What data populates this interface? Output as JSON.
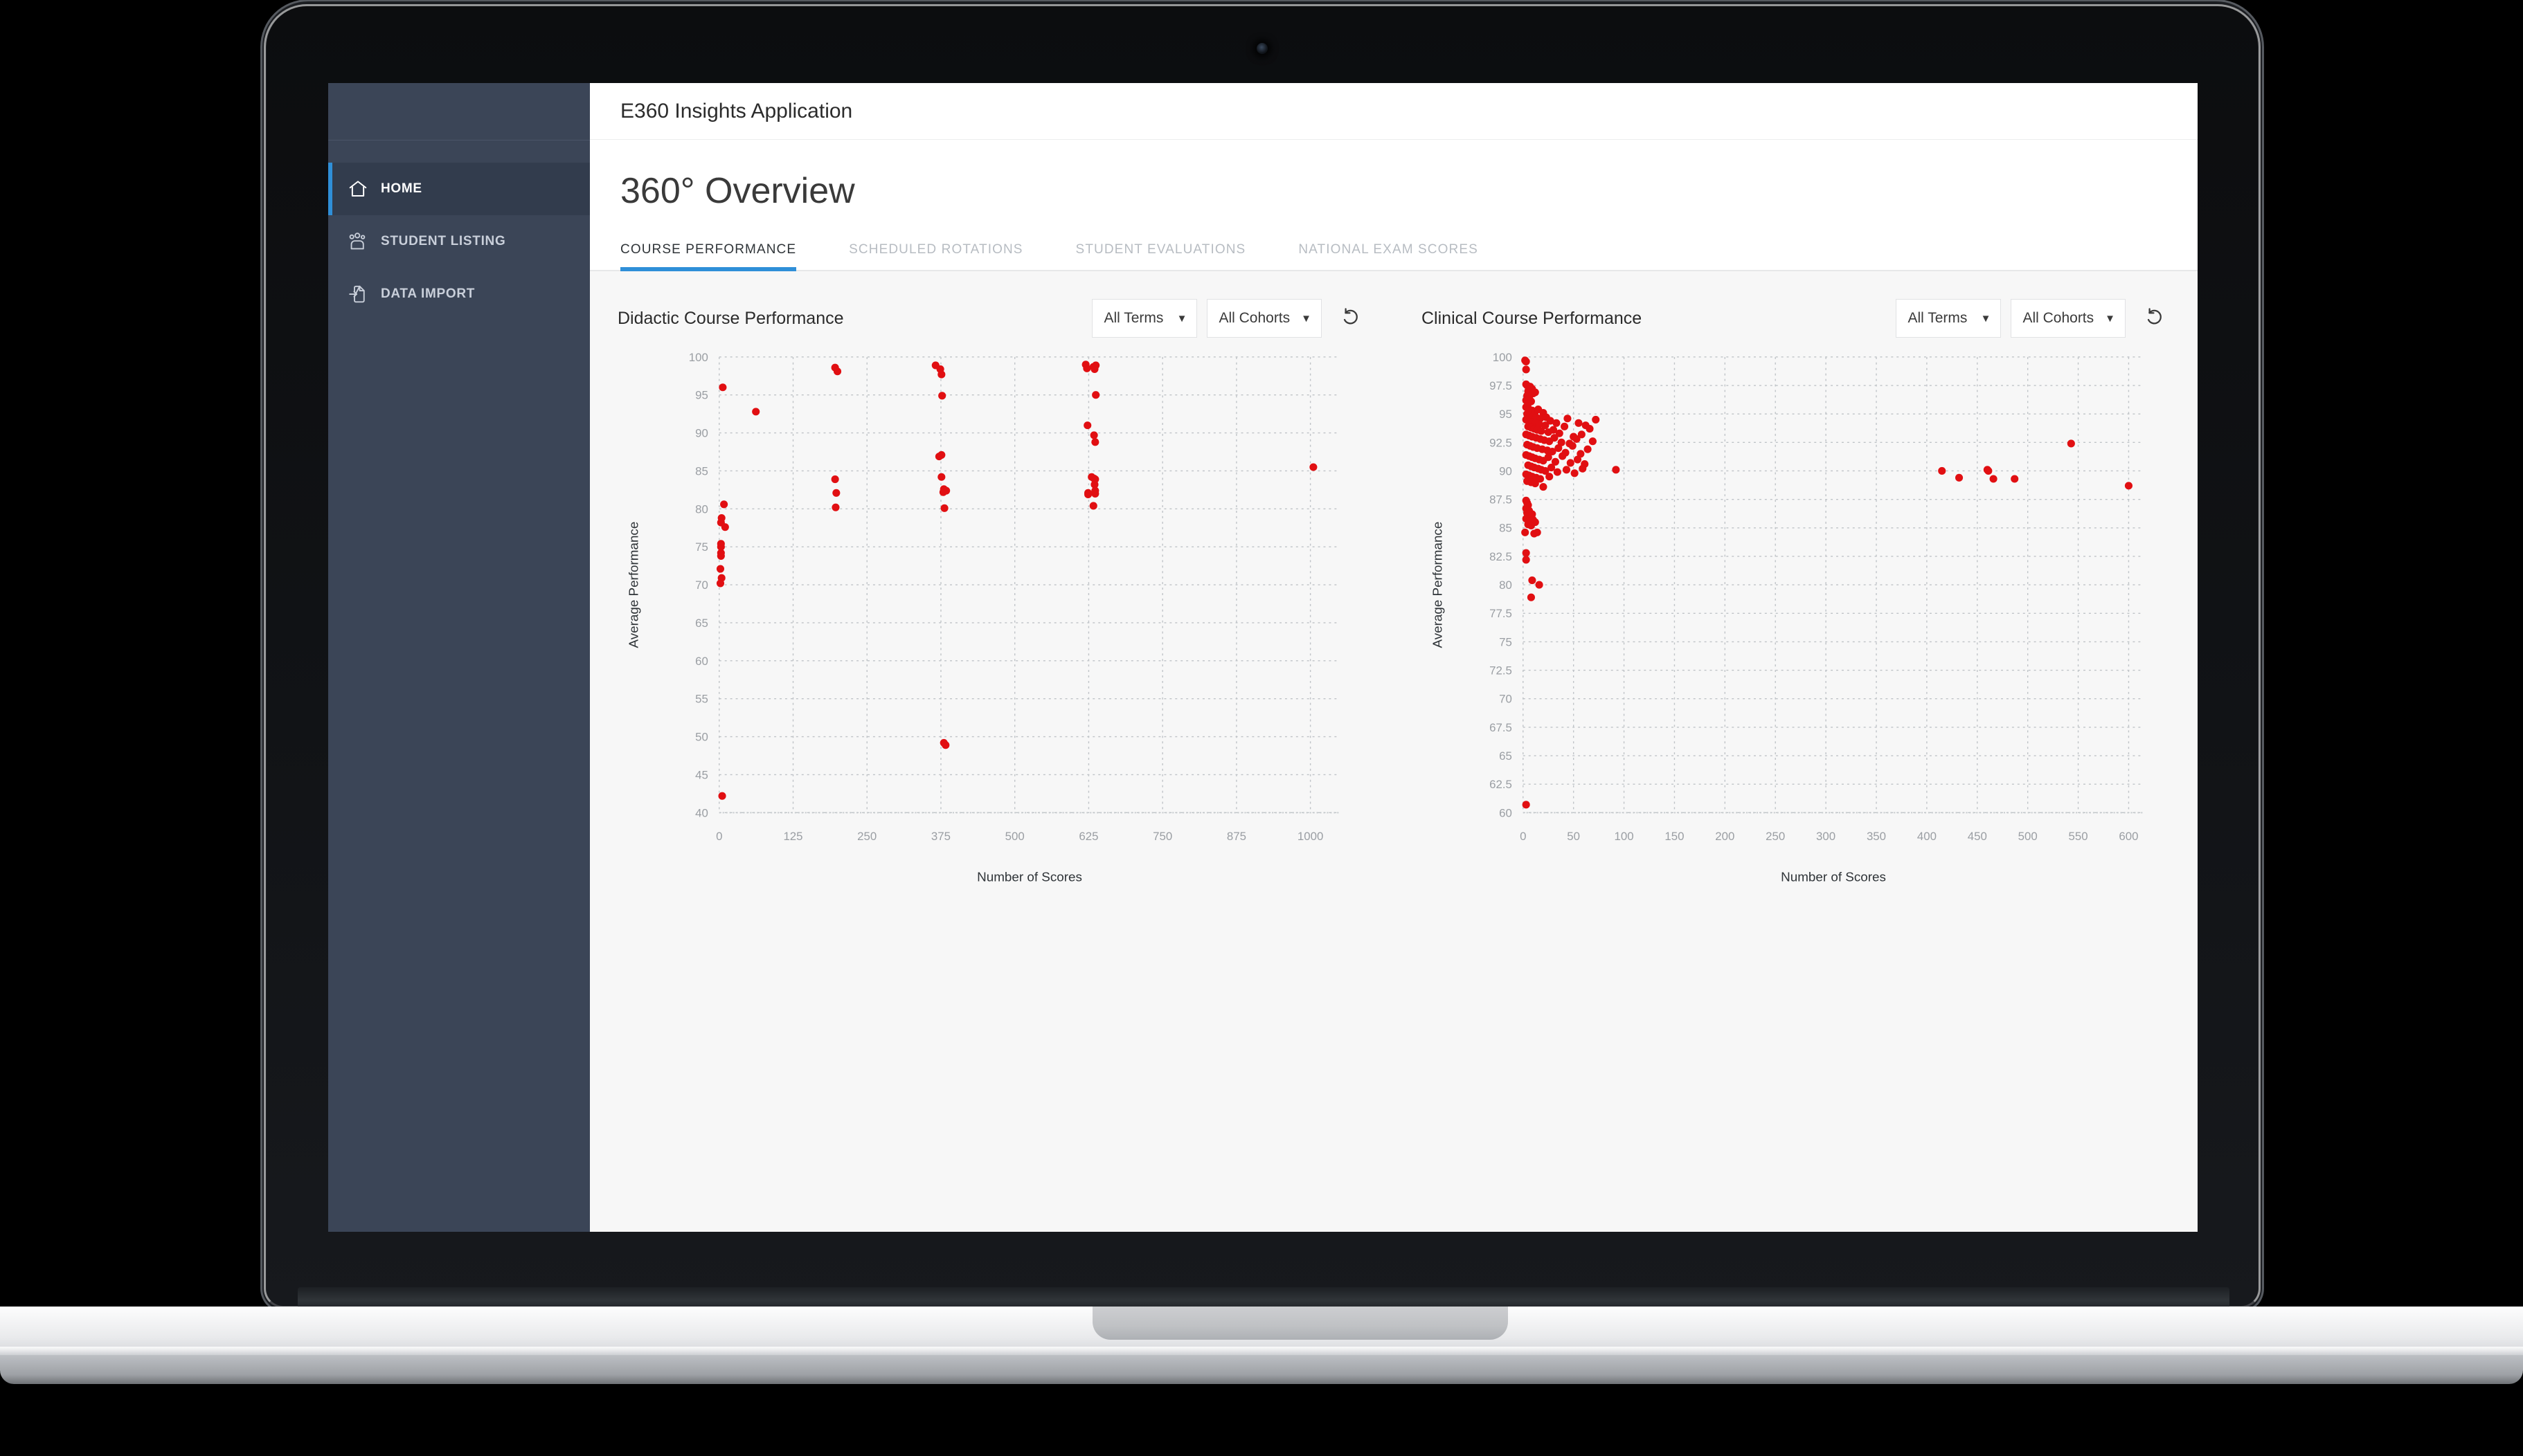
{
  "device": {
    "type": "laptop",
    "camera": "camera-dot"
  },
  "app": {
    "topbar_title": "E360 Insights Application",
    "page_title": "360° Overview"
  },
  "sidebar": {
    "items": [
      {
        "label": "HOME",
        "icon": "home-icon",
        "active": true
      },
      {
        "label": "STUDENT LISTING",
        "icon": "people-icon",
        "active": false
      },
      {
        "label": "DATA IMPORT",
        "icon": "file-import-icon",
        "active": false
      }
    ]
  },
  "tabs": [
    {
      "label": "COURSE PERFORMANCE",
      "active": true
    },
    {
      "label": "SCHEDULED ROTATIONS",
      "active": false
    },
    {
      "label": "STUDENT EVALUATIONS",
      "active": false
    },
    {
      "label": "NATIONAL EXAM SCORES",
      "active": false
    }
  ],
  "controls": {
    "term_filter": "All Terms",
    "cohort_filter": "All Cohorts",
    "caret": "▼",
    "refresh_icon": "refresh-counterclockwise-icon"
  },
  "colors": {
    "accent": "#2f8fd8",
    "sidebar": "#3b4557",
    "sidebar_active": "#323c4d",
    "point": "#e10f12",
    "page_bg": "#f7f7f7",
    "grid": "#bfc3c7"
  },
  "chart_data": [
    {
      "id": "didactic",
      "type": "scatter",
      "title": "Didactic Course Performance",
      "xlabel": "Number of Scores",
      "ylabel": "Average Performance",
      "xlim": [
        0,
        1050
      ],
      "ylim": [
        40,
        100
      ],
      "xticks": [
        0,
        125,
        250,
        375,
        500,
        625,
        750,
        875,
        1000
      ],
      "yticks": [
        40,
        45,
        50,
        55,
        60,
        65,
        70,
        75,
        80,
        85,
        90,
        95,
        100
      ],
      "grid": true,
      "legend": "none",
      "point_color": "#e10f12",
      "points": [
        [
          6,
          96.0
        ],
        [
          8,
          80.6
        ],
        [
          4,
          78.8
        ],
        [
          3,
          78.2
        ],
        [
          10,
          77.6
        ],
        [
          3,
          75.4
        ],
        [
          3,
          75.0
        ],
        [
          3,
          74.2
        ],
        [
          3,
          73.8
        ],
        [
          2,
          72.1
        ],
        [
          4,
          70.9
        ],
        [
          2,
          70.2
        ],
        [
          5,
          42.2
        ],
        [
          62,
          92.8
        ],
        [
          196,
          98.6
        ],
        [
          200,
          98.1
        ],
        [
          196,
          83.9
        ],
        [
          198,
          82.1
        ],
        [
          197,
          80.2
        ],
        [
          366,
          98.9
        ],
        [
          374,
          98.4
        ],
        [
          376,
          97.7
        ],
        [
          377,
          94.9
        ],
        [
          376,
          87.1
        ],
        [
          372,
          86.9
        ],
        [
          376,
          84.2
        ],
        [
          380,
          82.6
        ],
        [
          384,
          82.4
        ],
        [
          379,
          82.2
        ],
        [
          381,
          80.1
        ],
        [
          380,
          49.2
        ],
        [
          383,
          48.9
        ],
        [
          620,
          99.0
        ],
        [
          633,
          98.7
        ],
        [
          635,
          98.4
        ],
        [
          637,
          98.9
        ],
        [
          637,
          95.0
        ],
        [
          622,
          98.5
        ],
        [
          623,
          91.0
        ],
        [
          634,
          89.7
        ],
        [
          636,
          88.8
        ],
        [
          630,
          84.2
        ],
        [
          634,
          84.0
        ],
        [
          636,
          83.9
        ],
        [
          635,
          83.2
        ],
        [
          636,
          82.4
        ],
        [
          636,
          82.0
        ],
        [
          624,
          81.9
        ],
        [
          624,
          82.1
        ],
        [
          633,
          80.4
        ],
        [
          1005,
          85.5
        ]
      ]
    },
    {
      "id": "clinical",
      "type": "scatter",
      "title": "Clinical Course Performance",
      "xlabel": "Number of Scores",
      "ylabel": "Average Performance",
      "xlim": [
        0,
        615
      ],
      "ylim": [
        60,
        100
      ],
      "xticks": [
        0,
        50,
        100,
        150,
        200,
        250,
        300,
        350,
        400,
        450,
        500,
        550,
        600
      ],
      "yticks": [
        60,
        62.5,
        65,
        67.5,
        70,
        72.5,
        75,
        77.5,
        80,
        82.5,
        85,
        87.5,
        90,
        92.5,
        95,
        97.5,
        100
      ],
      "grid": true,
      "legend": "none",
      "point_color": "#e10f12",
      "points": [
        [
          2,
          99.7
        ],
        [
          3,
          99.6
        ],
        [
          3,
          98.9
        ],
        [
          3,
          97.6
        ],
        [
          4,
          97.5
        ],
        [
          7,
          97.4
        ],
        [
          9,
          97.2
        ],
        [
          5,
          97.0
        ],
        [
          10,
          96.8
        ],
        [
          12,
          96.9
        ],
        [
          4,
          96.6
        ],
        [
          6,
          96.4
        ],
        [
          3,
          96.2
        ],
        [
          8,
          96.1
        ],
        [
          5,
          95.9
        ],
        [
          3,
          95.6
        ],
        [
          6,
          95.4
        ],
        [
          9,
          95.3
        ],
        [
          12,
          95.2
        ],
        [
          15,
          95.4
        ],
        [
          20,
          95.1
        ],
        [
          4,
          95.0
        ],
        [
          7,
          94.9
        ],
        [
          10,
          94.8
        ],
        [
          13,
          94.7
        ],
        [
          17,
          94.6
        ],
        [
          23,
          94.7
        ],
        [
          3,
          94.5
        ],
        [
          6,
          94.4
        ],
        [
          9,
          94.3
        ],
        [
          12,
          94.2
        ],
        [
          16,
          94.1
        ],
        [
          22,
          94.0
        ],
        [
          27,
          94.4
        ],
        [
          33,
          94.2
        ],
        [
          44,
          94.6
        ],
        [
          55,
          94.2
        ],
        [
          62,
          94.0
        ],
        [
          72,
          94.5
        ],
        [
          5,
          93.9
        ],
        [
          8,
          93.8
        ],
        [
          11,
          93.7
        ],
        [
          14,
          93.6
        ],
        [
          18,
          93.5
        ],
        [
          25,
          93.4
        ],
        [
          30,
          93.6
        ],
        [
          36,
          93.3
        ],
        [
          41,
          93.9
        ],
        [
          50,
          93.0
        ],
        [
          58,
          93.2
        ],
        [
          66,
          93.7
        ],
        [
          3,
          93.2
        ],
        [
          6,
          93.1
        ],
        [
          9,
          93.0
        ],
        [
          13,
          92.9
        ],
        [
          17,
          92.8
        ],
        [
          21,
          92.7
        ],
        [
          26,
          92.6
        ],
        [
          31,
          92.9
        ],
        [
          38,
          92.5
        ],
        [
          46,
          92.4
        ],
        [
          53,
          92.8
        ],
        [
          69,
          92.6
        ],
        [
          4,
          92.3
        ],
        [
          7,
          92.2
        ],
        [
          10,
          92.1
        ],
        [
          14,
          92.0
        ],
        [
          19,
          91.9
        ],
        [
          24,
          91.8
        ],
        [
          29,
          91.7
        ],
        [
          35,
          92.0
        ],
        [
          42,
          91.6
        ],
        [
          49,
          92.2
        ],
        [
          57,
          91.5
        ],
        [
          64,
          91.9
        ],
        [
          3,
          91.4
        ],
        [
          6,
          91.3
        ],
        [
          9,
          91.2
        ],
        [
          12,
          91.1
        ],
        [
          16,
          91.0
        ],
        [
          20,
          90.9
        ],
        [
          25,
          91.2
        ],
        [
          32,
          90.8
        ],
        [
          39,
          91.3
        ],
        [
          47,
          90.7
        ],
        [
          54,
          91.0
        ],
        [
          61,
          90.6
        ],
        [
          5,
          90.5
        ],
        [
          8,
          90.4
        ],
        [
          11,
          90.3
        ],
        [
          15,
          90.2
        ],
        [
          18,
          90.1
        ],
        [
          22,
          90.0
        ],
        [
          28,
          90.3
        ],
        [
          34,
          89.9
        ],
        [
          43,
          90.1
        ],
        [
          51,
          89.8
        ],
        [
          59,
          90.2
        ],
        [
          92,
          90.1
        ],
        [
          3,
          89.7
        ],
        [
          6,
          89.6
        ],
        [
          9,
          89.5
        ],
        [
          13,
          89.4
        ],
        [
          17,
          89.3
        ],
        [
          26,
          89.5
        ],
        [
          4,
          89.1
        ],
        [
          8,
          89.0
        ],
        [
          12,
          88.9
        ],
        [
          20,
          88.6
        ],
        [
          3,
          87.4
        ],
        [
          4,
          87.2
        ],
        [
          5,
          87.0
        ],
        [
          3,
          86.7
        ],
        [
          6,
          86.5
        ],
        [
          4,
          86.3
        ],
        [
          5,
          86.1
        ],
        [
          7,
          86.0
        ],
        [
          9,
          86.2
        ],
        [
          3,
          85.8
        ],
        [
          6,
          85.6
        ],
        [
          10,
          85.7
        ],
        [
          12,
          85.5
        ],
        [
          5,
          85.3
        ],
        [
          8,
          85.2
        ],
        [
          2,
          84.6
        ],
        [
          11,
          84.5
        ],
        [
          14,
          84.6
        ],
        [
          3,
          82.8
        ],
        [
          3,
          82.2
        ],
        [
          9,
          80.4
        ],
        [
          16,
          80.0
        ],
        [
          8,
          78.9
        ],
        [
          3,
          60.7
        ],
        [
          415,
          90.0
        ],
        [
          432,
          89.4
        ],
        [
          460,
          90.1
        ],
        [
          461,
          90.0
        ],
        [
          466,
          89.3
        ],
        [
          487,
          89.3
        ],
        [
          543,
          92.4
        ],
        [
          600,
          88.7
        ]
      ]
    }
  ]
}
